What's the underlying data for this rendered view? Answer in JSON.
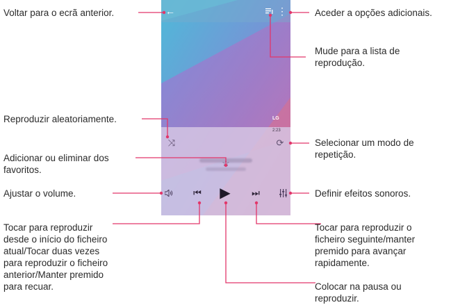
{
  "screen": {
    "logo": "LG",
    "time": "2:23",
    "icons": [
      "back-arrow-icon",
      "playlist-icon",
      "more-options-icon",
      "shuffle-icon",
      "star-icon",
      "repeat-icon",
      "volume-icon",
      "previous-icon",
      "play-icon",
      "next-icon",
      "equalizer-icon"
    ]
  },
  "labels": {
    "back": "Voltar para o ecrã anterior.",
    "more": "Aceder a opções adicionais.",
    "playlist": [
      "Mude para a lista de",
      "reprodução."
    ],
    "shuffle": "Reproduzir aleatoriamente.",
    "repeat": [
      "Selecionar um modo de",
      "repetição."
    ],
    "favorite": [
      "Adicionar ou eliminar dos",
      "favoritos."
    ],
    "volume": "Ajustar o volume.",
    "effects": "Definir efeitos sonoros.",
    "previous": [
      "Tocar para reproduzir",
      "desde o início do ficheiro",
      "atual/Tocar duas vezes",
      "para reproduzir o ficheiro",
      "anterior/Manter premido",
      "para recuar."
    ],
    "next": [
      "Tocar para reproduzir o",
      "ficheiro seguinte/manter",
      "premido para avançar",
      "rapidamente."
    ],
    "play": [
      "Colocar na pausa ou",
      "reproduzir."
    ]
  },
  "colors": {
    "callout": "#e2366a"
  }
}
